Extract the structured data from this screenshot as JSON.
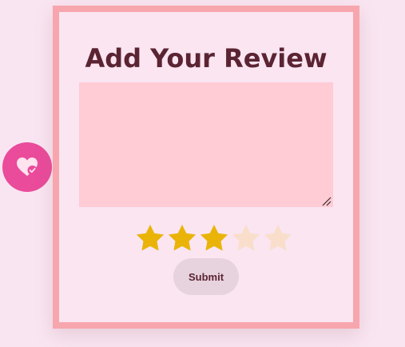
{
  "review_form": {
    "title": "Add Your Review",
    "textarea_value": "",
    "submit_label": "Submit"
  },
  "rating": {
    "value": 3,
    "max": 5
  },
  "fab": {
    "icon": "heart-check-icon"
  },
  "colors": {
    "page_background": "#f9e5f1",
    "card_border": "#f7a6ad",
    "card_background": "#fae5f1",
    "title_text": "#5b2433",
    "textarea_background": "#ffcbd5",
    "star_filled": "#eab308",
    "star_empty": "#f9dfcb",
    "submit_background": "#e7d3dd",
    "fab_background": "#ea4b9b"
  }
}
